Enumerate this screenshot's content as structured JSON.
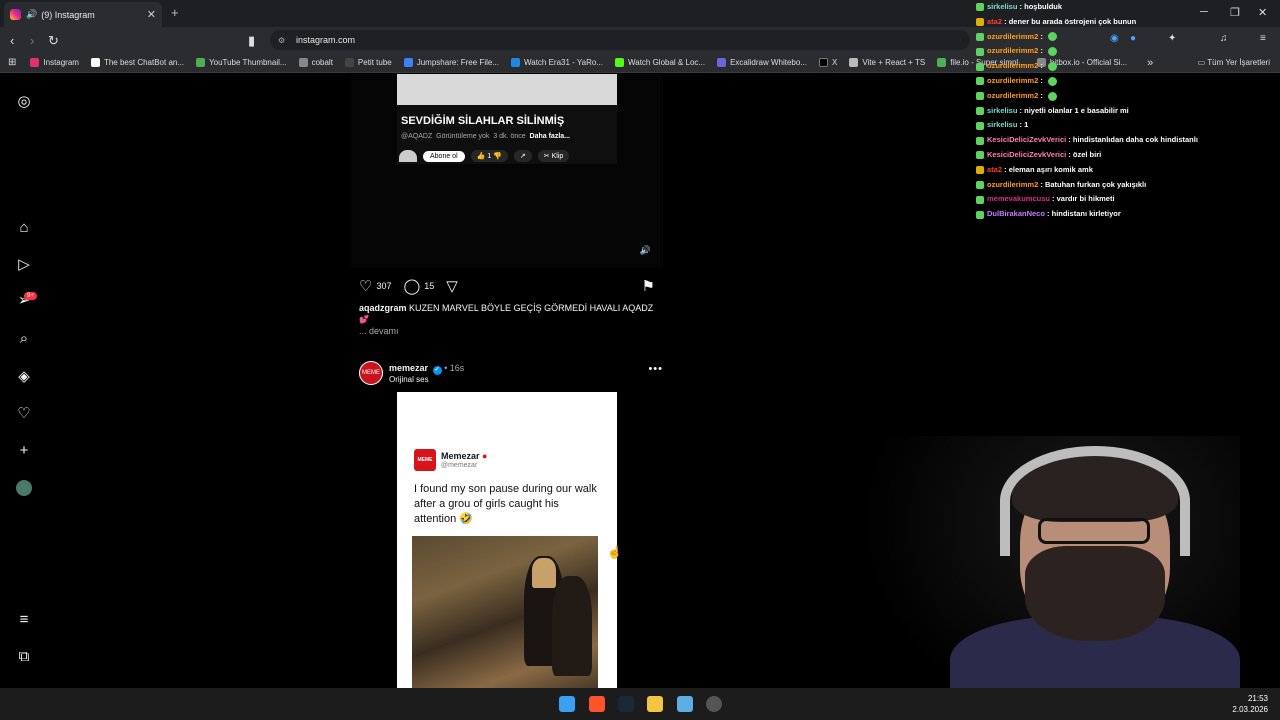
{
  "browser": {
    "tab_title": "(9) Instagram",
    "url": "instagram.com",
    "bookmarks": [
      {
        "label": "Instagram",
        "color": "#e1306c"
      },
      {
        "label": "The best ChatBot an...",
        "color": "#ffffff"
      },
      {
        "label": "YouTube Thumbnail...",
        "color": "#4caf50"
      },
      {
        "label": "cobalt",
        "color": "#888888"
      },
      {
        "label": "Petit tube",
        "color": "#222222"
      },
      {
        "label": "Jumpshare: Free File...",
        "color": "#3b82f6"
      },
      {
        "label": "Watch Era31 - YaRo...",
        "color": "#1e88e5"
      },
      {
        "label": "Watch Global & Loc...",
        "color": "#53fc18"
      },
      {
        "label": "Excalidraw Whitebo...",
        "color": "#6965db"
      },
      {
        "label": "X",
        "color": "#000000"
      },
      {
        "label": "Vite + React + TS",
        "color": "#bbbbbb"
      },
      {
        "label": "file.io - Super simpl...",
        "color": "#4caf50"
      },
      {
        "label": "hitbox.io - Official Si...",
        "color": "#888888"
      }
    ],
    "bookmarks_more": "»",
    "all_bookmarks": "Tüm Yer İşaretleri"
  },
  "post1": {
    "yt_title": "SEVDİĞİM SİLAHLAR SİLİNMİŞ",
    "yt_channel": "@AQADZ",
    "yt_views": "Görüntüleme yok",
    "yt_time": "3 dk. önce",
    "yt_more": "Daha fazla...",
    "yt_subscribe": "Abone ol",
    "yt_likes": "1",
    "yt_clip": "Klip",
    "likes": "307",
    "comments": "15",
    "caption_user": "aqadzgram",
    "caption_text": "KUZEN MARVEL BÖYLE GEÇİŞ GÖRMEDİ HAVALI AQADZ",
    "more": "... devamı"
  },
  "post2": {
    "username": "memezar",
    "time": "16s",
    "audio": "Orijinal ses",
    "card_name": "Memezar",
    "card_handle": "@memezar",
    "card_text": "I found my son pause during our walk after a grou of girls caught his attention 🤣"
  },
  "sidebar": {
    "notif_badge": "9+"
  },
  "chat": [
    {
      "user": "sirkelisu",
      "color": "#7fd8d0",
      "msg": "hoşbulduk"
    },
    {
      "user": "ata2",
      "color": "#ff3b30",
      "msg": "dener bu arada östrojeni çok bunun"
    },
    {
      "user": "ozurdilerimm2",
      "color": "#ff9f1c",
      "msg": ""
    },
    {
      "user": "ozurdilerimm2",
      "color": "#ff9f1c",
      "msg": ""
    },
    {
      "user": "ozurdilerimm2",
      "color": "#ff9f1c",
      "msg": ""
    },
    {
      "user": "ozurdilerimm2",
      "color": "#ff9f1c",
      "msg": ""
    },
    {
      "user": "ozurdilerimm2",
      "color": "#ff9f1c",
      "msg": ""
    },
    {
      "user": "sirkelisu",
      "color": "#7fd8d0",
      "msg": "niyetli olanlar 1 e basabilir mi"
    },
    {
      "user": "sirkelisu",
      "color": "#7fd8d0",
      "msg": "1"
    },
    {
      "user": "KesiciDeliciZevkVerici",
      "color": "#ff7eb6",
      "msg": "hindistanlıdan daha cok hindistanlı"
    },
    {
      "user": "KesiciDeliciZevkVerici",
      "color": "#ff7eb6",
      "msg": "özel biri"
    },
    {
      "user": "ata2",
      "color": "#ff3b30",
      "msg": "eleman aşırı komik amk"
    },
    {
      "user": "ozurdilerimm2",
      "color": "#ff9f1c",
      "msg": "Batuhan furkan çok yakışıklı"
    },
    {
      "user": "memevakumcusu",
      "color": "#d63384",
      "msg": "vardır bi hikmeti"
    },
    {
      "user": "DulBirakanNeco",
      "color": "#c77dff",
      "msg": "hindistanı kirletiyor"
    }
  ],
  "taskbar": {
    "time": "21:53",
    "date": "2.03.2026"
  }
}
